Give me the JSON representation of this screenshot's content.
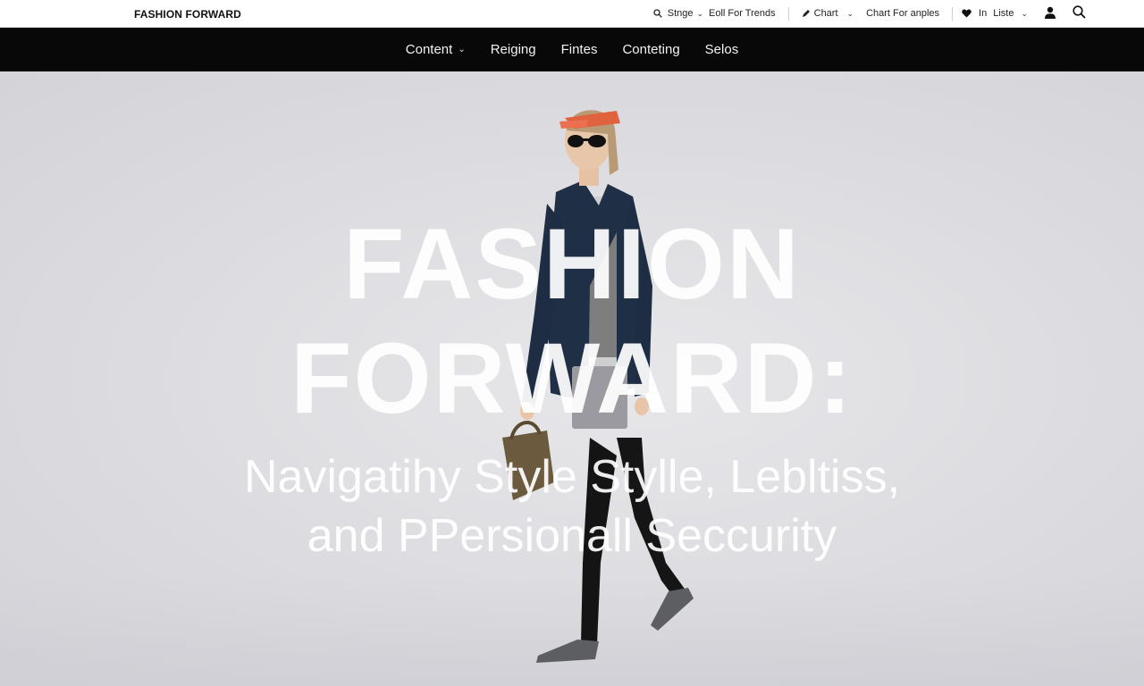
{
  "brand": "FASHION FORWARD",
  "utility": {
    "shop_label": "Stnge",
    "trends_label": "Eoll For Trends",
    "chart_label": "Chart",
    "chart_examples_label": "Chart For anples",
    "list_prefix": "In",
    "list_label": "Liste"
  },
  "nav": {
    "items": [
      {
        "label": "Content",
        "has_dropdown": true
      },
      {
        "label": "Reiging"
      },
      {
        "label": "Fintes"
      },
      {
        "label": "Conteting"
      },
      {
        "label": "Selos"
      }
    ]
  },
  "hero": {
    "headline_line1": "FASHION",
    "headline_line2": "FORWARD:",
    "subtitle_line1": "Navigatihy Style Stylle, Lebltiss,",
    "subtitle_line2": "and PPersionall Seccurity"
  },
  "colors": {
    "topbar_bg": "#ffffff",
    "nav_bg": "#080808",
    "hero_bg": "#dcdce0",
    "visor": "#e0623f",
    "jacket": "#1f2f45",
    "bag": "#6b5a3d"
  },
  "icons": [
    "search-icon",
    "chevron-down-icon",
    "pen-icon",
    "heart-icon",
    "user-icon"
  ]
}
